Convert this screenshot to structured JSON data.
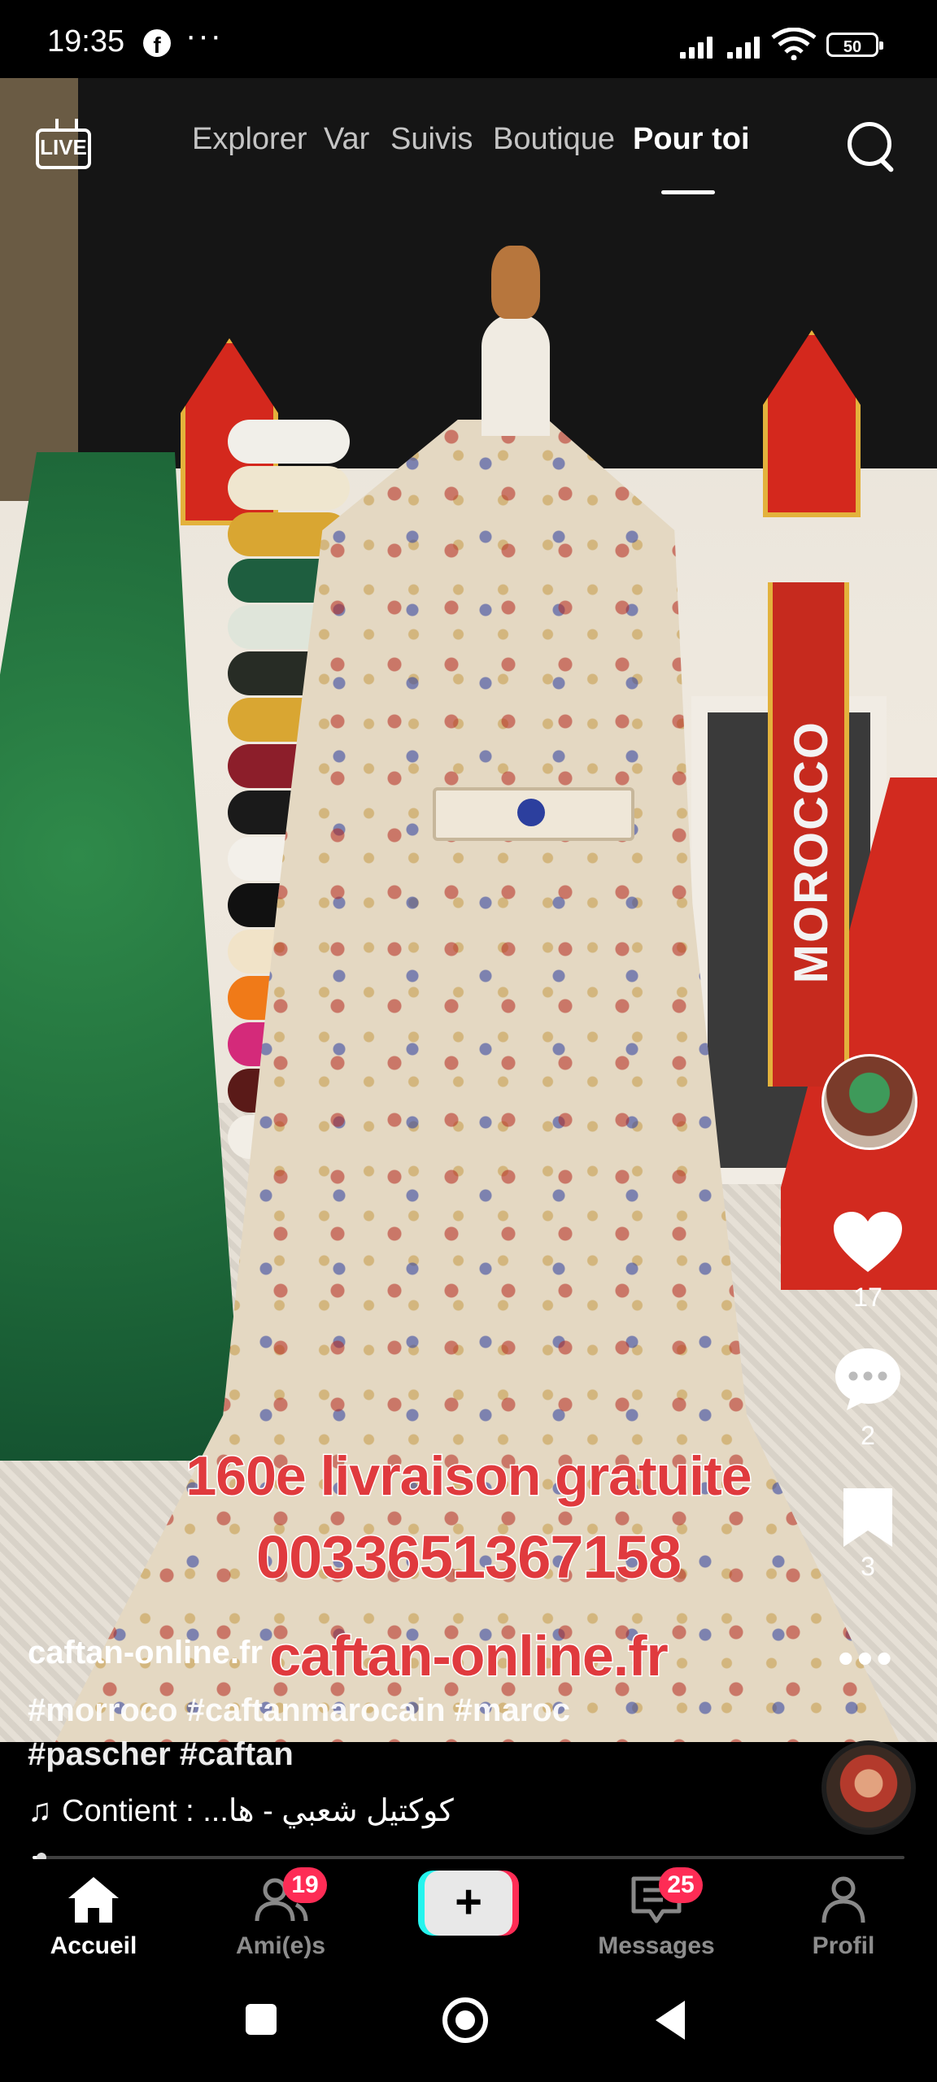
{
  "status_bar": {
    "time": "19:35",
    "app_icon": "facebook-icon",
    "more": "···",
    "battery": "50"
  },
  "top_nav": {
    "live_label": "LIVE",
    "tabs": [
      {
        "label": "Explorer",
        "active": false
      },
      {
        "label": "Var",
        "active": false
      },
      {
        "label": "Suivis",
        "active": false
      },
      {
        "label": "Boutique",
        "active": false
      },
      {
        "label": "Pour toi",
        "active": true
      }
    ]
  },
  "video": {
    "banner_text": "MOROCCO",
    "overlay_lines": [
      "160e livraison gratuite",
      "0033651367158",
      "caftan-online.fr"
    ]
  },
  "actions": {
    "likes": "17",
    "comments": "2",
    "saves": "3"
  },
  "caption": {
    "username": "caftan-online.fr",
    "hashtags": "#morroco #caftanmarocain #maroc #pascher #caftan",
    "music": "Contient : ...كوكتيل شعبي - ها"
  },
  "playback": {
    "progress": 0.01
  },
  "bottom_nav": {
    "items": [
      {
        "label": "Accueil",
        "icon": "home-icon",
        "active": true,
        "badge": ""
      },
      {
        "label": "Ami(e)s",
        "icon": "friends-icon",
        "active": false,
        "badge": "19"
      },
      {
        "label": "",
        "icon": "plus-icon",
        "active": false,
        "badge": ""
      },
      {
        "label": "Messages",
        "icon": "messages-icon",
        "active": false,
        "badge": "25"
      },
      {
        "label": "Profil",
        "icon": "profile-icon",
        "active": false,
        "badge": ""
      }
    ]
  },
  "colors": {
    "accent": "#fe2c55",
    "accent_cyan": "#25f4ee",
    "overlay_text": "#e03a3e"
  }
}
